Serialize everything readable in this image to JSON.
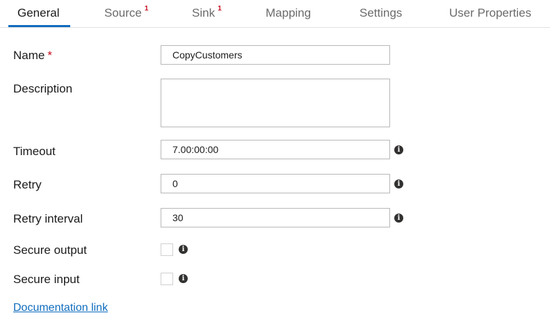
{
  "tabs": [
    {
      "label": "General",
      "badge": ""
    },
    {
      "label": "Source",
      "badge": "1"
    },
    {
      "label": "Sink",
      "badge": "1"
    },
    {
      "label": "Mapping",
      "badge": ""
    },
    {
      "label": "Settings",
      "badge": ""
    },
    {
      "label": "User Properties",
      "badge": ""
    }
  ],
  "active_tab": "General",
  "form": {
    "name": {
      "label": "Name",
      "required_mark": "*",
      "value": "CopyCustomers"
    },
    "description": {
      "label": "Description",
      "value": ""
    },
    "timeout": {
      "label": "Timeout",
      "value": "7.00:00:00"
    },
    "retry": {
      "label": "Retry",
      "value": "0"
    },
    "retry_interval": {
      "label": "Retry interval",
      "value": "30"
    },
    "secure_output": {
      "label": "Secure output",
      "checked": false
    },
    "secure_input": {
      "label": "Secure input",
      "checked": false
    }
  },
  "info_icon_glyph": "i",
  "documentation_link": "Documentation link",
  "colors": {
    "accent": "#0f6cbd",
    "required": "#c50f1f"
  }
}
